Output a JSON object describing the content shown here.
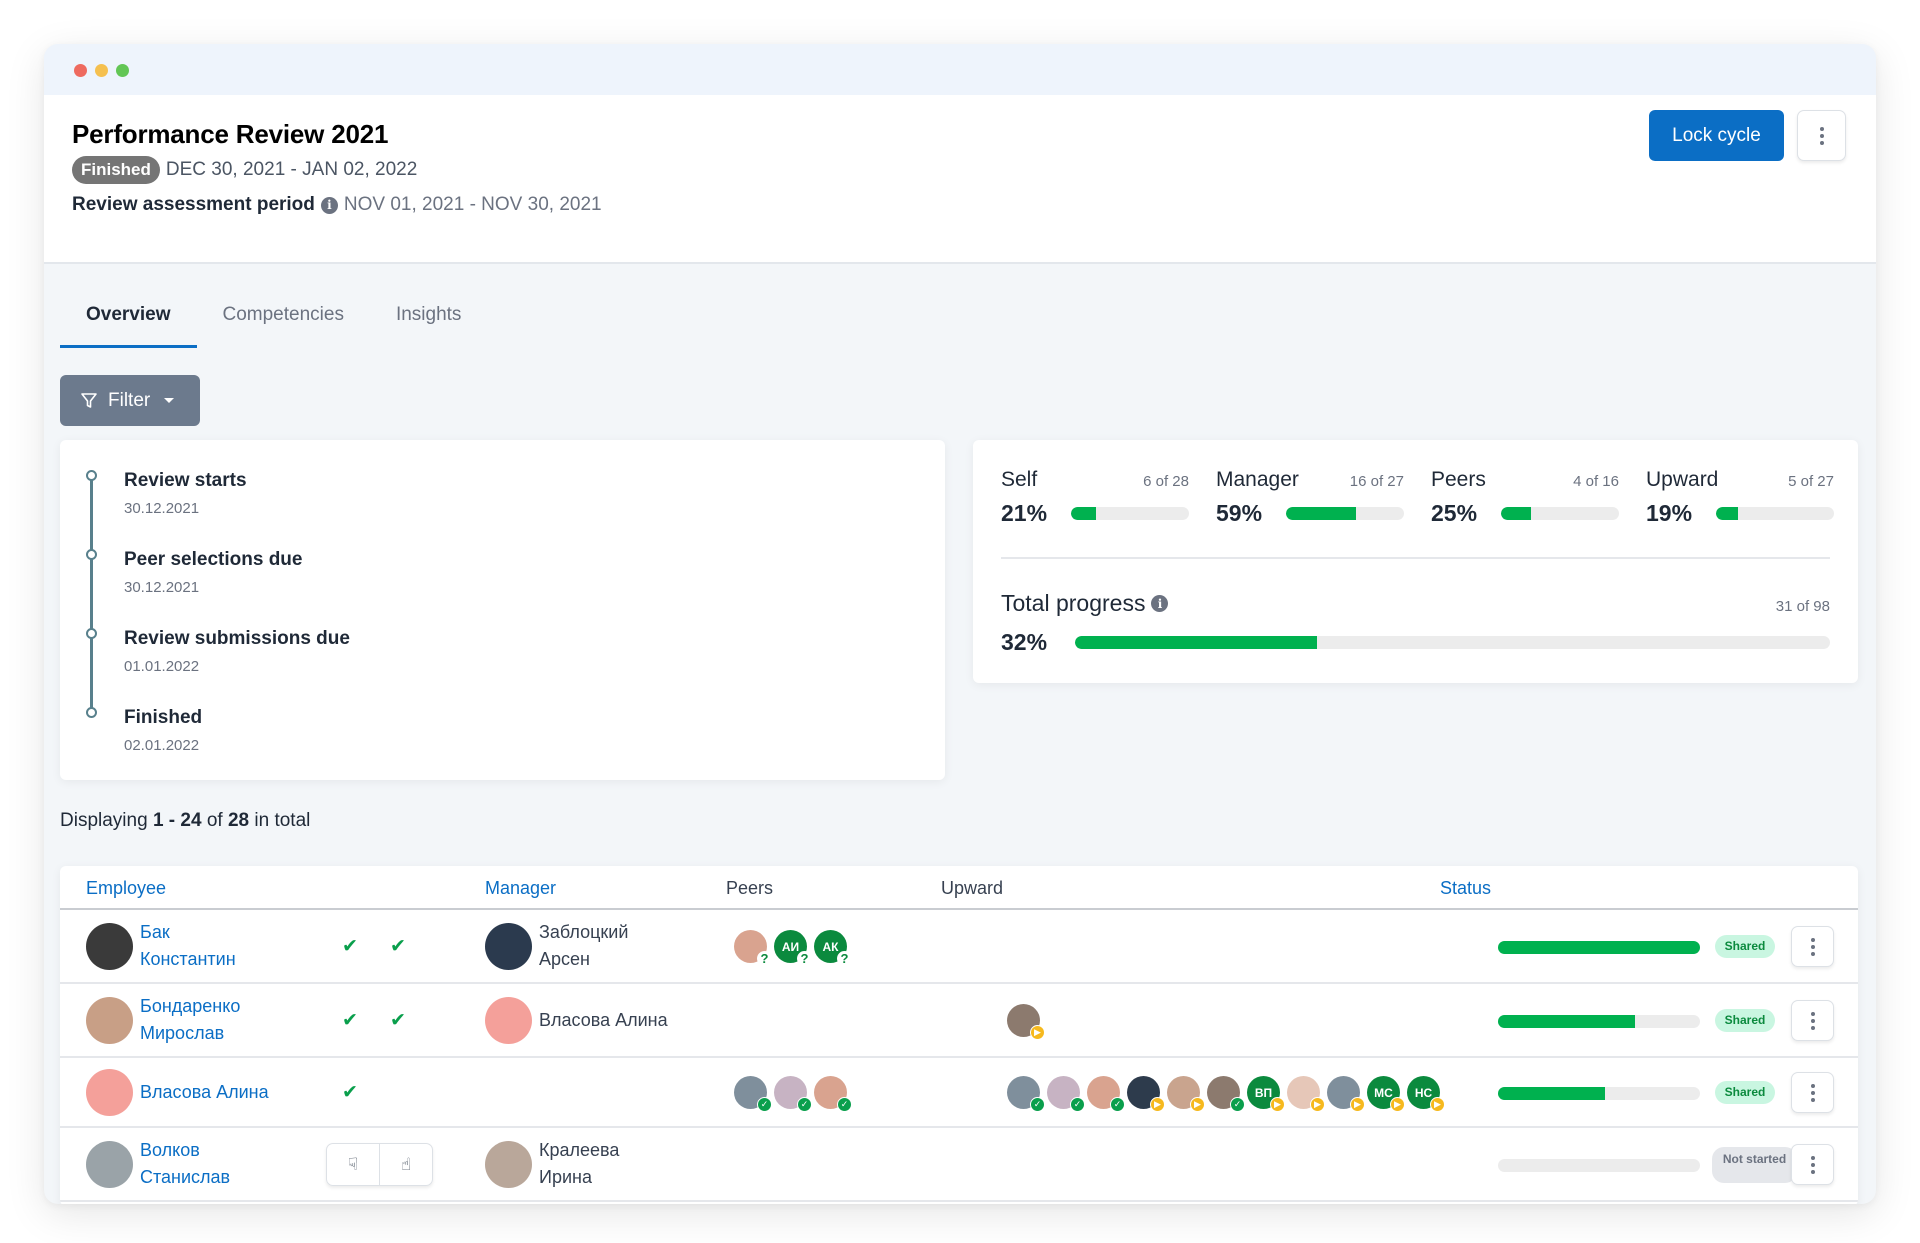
{
  "window": {
    "controls": [
      "close",
      "minimize",
      "maximize"
    ]
  },
  "header": {
    "title": "Performance Review 2021",
    "status_badge": "Finished",
    "date_range": "DEC 30, 2021 - JAN 02, 2022",
    "period_label": "Review assessment period",
    "period_value": "NOV 01, 2021 - NOV 30, 2021",
    "lock_button": "Lock cycle"
  },
  "tabs": [
    {
      "label": "Overview",
      "active": true
    },
    {
      "label": "Competencies",
      "active": false
    },
    {
      "label": "Insights",
      "active": false
    }
  ],
  "filter": {
    "label": "Filter"
  },
  "timeline": [
    {
      "title": "Review starts",
      "date": "30.12.2021"
    },
    {
      "title": "Peer selections due",
      "date": "30.12.2021"
    },
    {
      "title": "Review submissions due",
      "date": "01.01.2022"
    },
    {
      "title": "Finished",
      "date": "02.01.2022"
    }
  ],
  "progress": {
    "metrics": [
      {
        "name": "Self",
        "count": "6 of 28",
        "pct_label": "21%",
        "pct": 21
      },
      {
        "name": "Manager",
        "count": "16 of 27",
        "pct_label": "59%",
        "pct": 59
      },
      {
        "name": "Peers",
        "count": "4 of 16",
        "pct_label": "25%",
        "pct": 25
      },
      {
        "name": "Upward",
        "count": "5 of 27",
        "pct_label": "19%",
        "pct": 19
      }
    ],
    "total": {
      "name": "Total progress",
      "count": "31 of 98",
      "pct_label": "32%",
      "pct": 32
    }
  },
  "listing": {
    "prefix": "Displaying",
    "range": "1 - 24",
    "of": "of",
    "total": "28",
    "suffix": "in total"
  },
  "table": {
    "columns": {
      "employee": "Employee",
      "manager": "Manager",
      "peers": "Peers",
      "upward": "Upward",
      "status": "Status"
    },
    "rows": [
      {
        "employee_line1": "Бак",
        "employee_line2": "Константин",
        "checks": 2,
        "manager_line1": "Заблоцкий",
        "manager_line2": "Арсен",
        "peers": [
          {
            "initials": "",
            "state": "question"
          },
          {
            "initials": "АИ",
            "state": "question"
          },
          {
            "initials": "АК",
            "state": "question"
          }
        ],
        "upward": [],
        "progress": 100,
        "status": "Shared"
      },
      {
        "employee_line1": "Бондаренко",
        "employee_line2": "Мирослав",
        "checks": 2,
        "manager_line1": "Власова Алина",
        "manager_line2": "",
        "peers": [],
        "upward": [
          {
            "initials": "",
            "state": "pending"
          }
        ],
        "progress": 68,
        "status": "Shared"
      },
      {
        "employee_line1": "Власова Алина",
        "employee_line2": "",
        "checks": 1,
        "manager_line1": "",
        "manager_line2": "",
        "peers": [
          {
            "initials": "",
            "state": "done"
          },
          {
            "initials": "",
            "state": "done"
          },
          {
            "initials": "",
            "state": "done"
          }
        ],
        "upward": [
          {
            "initials": "",
            "state": "done"
          },
          {
            "initials": "",
            "state": "done"
          },
          {
            "initials": "",
            "state": "done"
          },
          {
            "initials": "",
            "state": "pending"
          },
          {
            "initials": "",
            "state": "pending"
          },
          {
            "initials": "",
            "state": "done"
          },
          {
            "initials": "ВП",
            "state": "pending"
          },
          {
            "initials": "",
            "state": "pending"
          },
          {
            "initials": "",
            "state": "pending"
          },
          {
            "initials": "МС",
            "state": "pending"
          },
          {
            "initials": "НС",
            "state": "pending"
          }
        ],
        "progress": 53,
        "status": "Shared"
      },
      {
        "employee_line1": "Волков",
        "employee_line2": "Станислав",
        "checks": 0,
        "manager_line1": "Кралеева",
        "manager_line2": "Ирина",
        "peers": [],
        "upward": [],
        "progress": 0,
        "status": "Not started"
      }
    ]
  },
  "colors": {
    "accent": "#0b6ec5",
    "progress": "#00b14f",
    "success": "#0a9f4c",
    "pending": "#f6b91e"
  }
}
